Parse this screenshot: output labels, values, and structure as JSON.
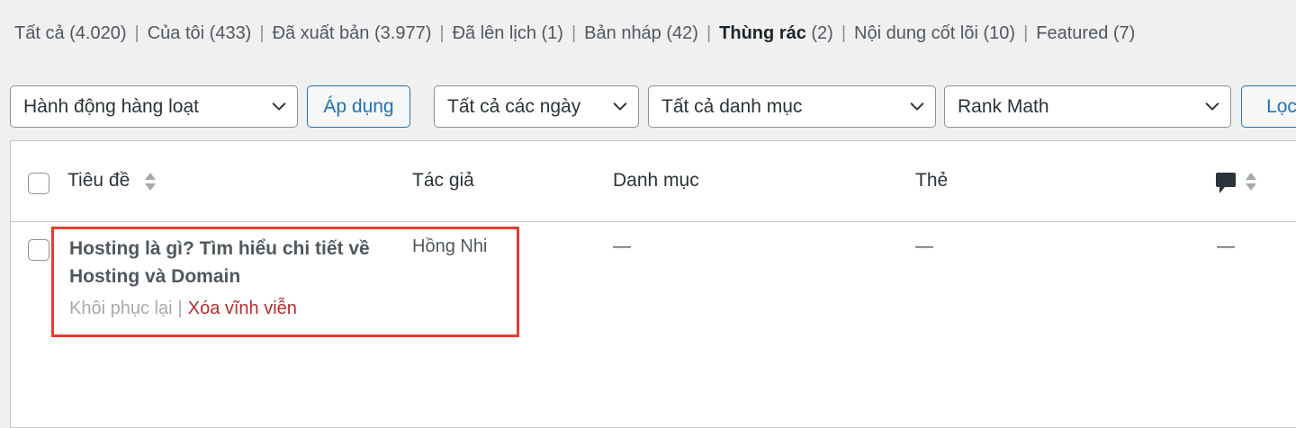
{
  "status_links": [
    {
      "label": "Tất cả",
      "count": "(4.020)",
      "current": false
    },
    {
      "label": "Của tôi",
      "count": "(433)",
      "current": false
    },
    {
      "label": "Đã xuất bản",
      "count": "(3.977)",
      "current": false
    },
    {
      "label": "Đã lên lịch",
      "count": "(1)",
      "current": false
    },
    {
      "label": "Bản nháp",
      "count": "(42)",
      "current": false
    },
    {
      "label": "Thùng rác",
      "count": "(2)",
      "current": true
    },
    {
      "label": "Nội dung cốt lõi",
      "count": "(10)",
      "current": false
    },
    {
      "label": "Featured",
      "count": "(7)",
      "current": false
    }
  ],
  "separator": "|",
  "toolbar": {
    "bulk_action": "Hành động hàng loạt",
    "apply": "Áp dụng",
    "date_filter": "Tất cả các ngày",
    "category_filter": "Tất cả danh mục",
    "rank_math_filter": "Rank Math",
    "filter_button": "Lọc"
  },
  "table": {
    "columns": {
      "title": "Tiêu đề",
      "author": "Tác giả",
      "categories": "Danh mục",
      "tags": "Thẻ",
      "comments_icon": "comment-bubble-icon"
    },
    "rows": [
      {
        "title": "Hosting là gì? Tìm hiểu chi tiết về Hosting và Domain",
        "author": "Hồng Nhi",
        "categories": "—",
        "tags": "—",
        "comments": "—",
        "actions": {
          "restore": "Khôi phục lại",
          "delete": "Xóa vĩnh viễn"
        }
      }
    ]
  },
  "colors": {
    "accent": "#2271b1",
    "delete": "#b32d2e",
    "highlight_border": "#e53d2f"
  }
}
